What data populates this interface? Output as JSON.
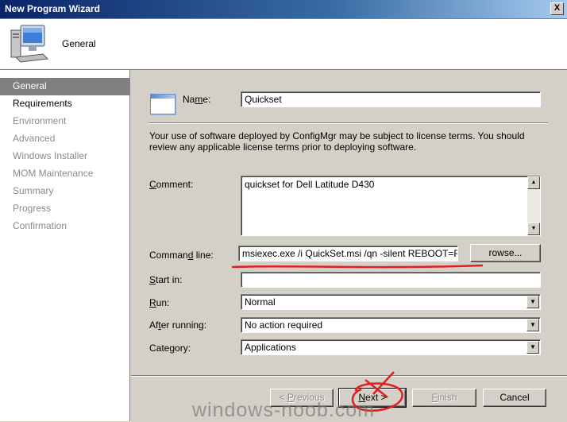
{
  "window": {
    "title": "New Program Wizard",
    "close_glyph": "X"
  },
  "header": {
    "title": "General",
    "icon": "computer-icon"
  },
  "sidebar": {
    "steps": [
      {
        "label": "General",
        "state": "active"
      },
      {
        "label": "Requirements",
        "state": "enabled"
      },
      {
        "label": "Environment",
        "state": "disabled"
      },
      {
        "label": "Advanced",
        "state": "disabled"
      },
      {
        "label": "Windows Installer",
        "state": "disabled"
      },
      {
        "label": "MOM Maintenance",
        "state": "disabled"
      },
      {
        "label": "Summary",
        "state": "disabled"
      },
      {
        "label": "Progress",
        "state": "disabled"
      },
      {
        "label": "Confirmation",
        "state": "disabled"
      }
    ]
  },
  "form": {
    "name_label_pre": "Na",
    "name_label_key": "m",
    "name_label_post": "e:",
    "name_value": "Quickset",
    "license_text": "Your use of software deployed by ConfigMgr may be subject to license terms. You should review any applicable license terms prior to deploying software.",
    "comment_label_key": "C",
    "comment_label_post": "omment:",
    "comment_value": "quickset for Dell Latitude D430",
    "command_label_pre": "Comman",
    "command_label_key": "d",
    "command_label_post": " line:",
    "command_value": "msiexec.exe /i QuickSet.msi /qn -silent REBOOT=ReallyS",
    "browse_key": "B",
    "browse_post": "rowse...",
    "start_label_key": "S",
    "start_label_post": "tart in:",
    "start_value": "",
    "run_label_key": "R",
    "run_label_post": "un:",
    "run_value": "Normal",
    "after_label_pre": "Af",
    "after_label_key": "t",
    "after_label_post": "er running:",
    "after_value": "No action required",
    "category_label_pre": "Cate",
    "category_label_key": "g",
    "category_label_post": "ory:",
    "category_value": "Applications"
  },
  "buttons": {
    "previous_pre": "< ",
    "previous_key": "P",
    "previous_post": "revious",
    "next_key": "N",
    "next_post": "ext >",
    "finish_key": "F",
    "finish_post": "inish",
    "cancel": "Cancel"
  },
  "annotation_color": "#e02020",
  "watermark": "windows-noob.com"
}
